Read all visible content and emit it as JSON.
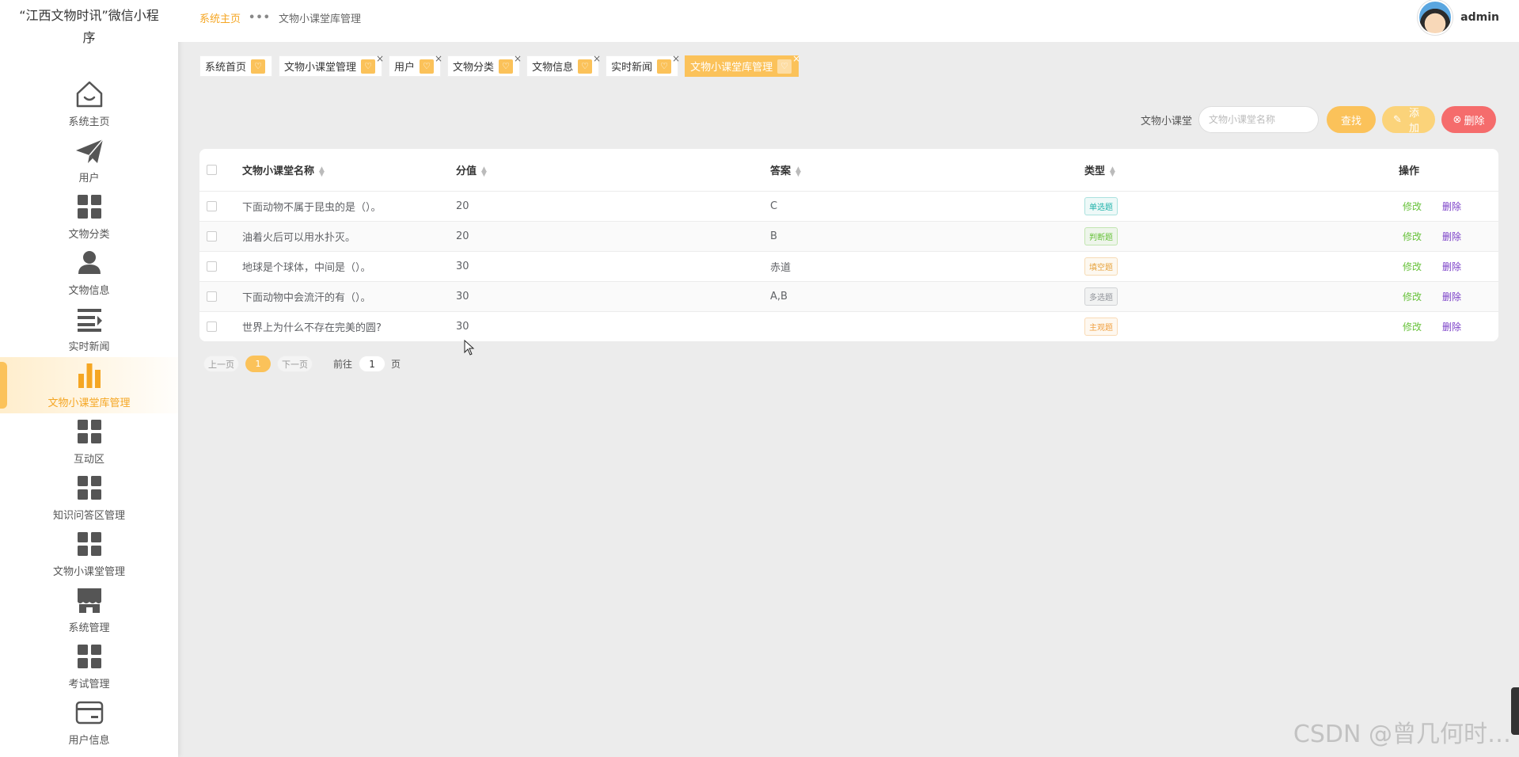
{
  "app": {
    "title": "“江西文物时讯”微信小程序"
  },
  "sidebar": {
    "items": [
      {
        "label": "系统主页",
        "icon": "home-icon"
      },
      {
        "label": "用户",
        "icon": "paper-plane-icon"
      },
      {
        "label": "文物分类",
        "icon": "grid-icon"
      },
      {
        "label": "文物信息",
        "icon": "person-icon"
      },
      {
        "label": "实时新闻",
        "icon": "list-icon"
      },
      {
        "label": "文物小课堂库管理",
        "icon": "bar-chart-icon",
        "active": true
      },
      {
        "label": "互动区",
        "icon": "grid-icon"
      },
      {
        "label": "知识问答区管理",
        "icon": "grid-icon"
      },
      {
        "label": "文物小课堂管理",
        "icon": "grid-icon"
      },
      {
        "label": "系统管理",
        "icon": "store-icon"
      },
      {
        "label": "考试管理",
        "icon": "grid-icon"
      },
      {
        "label": "用户信息",
        "icon": "card-icon"
      }
    ]
  },
  "header": {
    "breadcrumb_home": "系统主页",
    "breadcrumb_sep": "•••",
    "breadcrumb_current": "文物小课堂库管理",
    "username": "admin"
  },
  "tabs": [
    {
      "label": "系统首页",
      "closable": false
    },
    {
      "label": "文物小课堂管理",
      "closable": true
    },
    {
      "label": "用户",
      "closable": true
    },
    {
      "label": "文物分类",
      "closable": true
    },
    {
      "label": "文物信息",
      "closable": true
    },
    {
      "label": "实时新闻",
      "closable": true
    },
    {
      "label": "文物小课堂库管理",
      "closable": true,
      "active": true
    }
  ],
  "search": {
    "label": "文物小课堂",
    "placeholder": "文物小课堂名称",
    "find_label": "查找",
    "add_label": "添加",
    "delete_label": "删除"
  },
  "table": {
    "columns": [
      "文物小课堂名称",
      "分值",
      "答案",
      "类型",
      "操作"
    ],
    "rows": [
      {
        "name": "下面动物不属于昆虫的是（）。",
        "score": "20",
        "answer": "C",
        "type": "单选题",
        "type_color": "#20b2aa"
      },
      {
        "name": "油着火后可以用水扑灭。",
        "score": "20",
        "answer": "B",
        "type": "判断题",
        "type_color": "#67c23a"
      },
      {
        "name": "地球是个球体，中间是（）。",
        "score": "30",
        "answer": "赤道",
        "type": "填空题",
        "type_color": "#e6a23c"
      },
      {
        "name": "下面动物中会流汗的有（）。",
        "score": "30",
        "answer": "A,B",
        "type": "多选题",
        "type_color": "#909399"
      },
      {
        "name": "世界上为什么不存在完美的圆?",
        "score": "30",
        "answer": "",
        "type": "主观题",
        "type_color": "#f0a040"
      }
    ],
    "edit_label": "修改",
    "delete_label": "删除"
  },
  "pagination": {
    "prev_label": "上一页",
    "current_page": "1",
    "next_label": "下一页",
    "goto_label": "前往",
    "goto_value": "1",
    "page_suffix": "页"
  },
  "watermark": "CSDN @曾几何时…",
  "colors": {
    "accent": "#fbc25a",
    "danger": "#f56c6c",
    "edit": "#67c23a",
    "delete_link": "#7a3fc7"
  }
}
